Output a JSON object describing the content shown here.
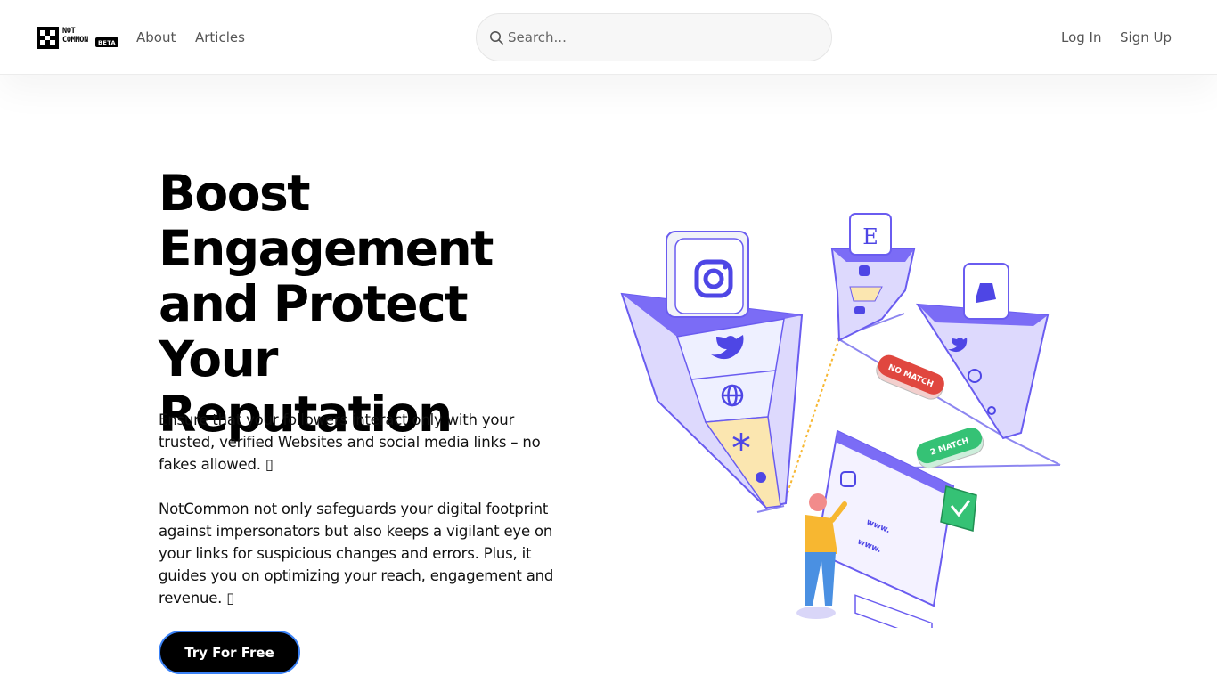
{
  "header": {
    "logo": {
      "line1": "NOT",
      "line2": "COMMON",
      "badge": "BETA"
    },
    "nav": {
      "about": "About",
      "articles": "Articles"
    },
    "search": {
      "placeholder": "Search...",
      "value": ""
    },
    "auth": {
      "login": "Log In",
      "signup": "Sign Up"
    }
  },
  "hero": {
    "title": "Boost Engagement and Protect Your Reputation",
    "paragraph1": "Ensure that your followers interact only with your trusted, verified Websites and social media links – no fakes allowed. ▯",
    "paragraph2": "NotCommon not only safeguards your digital footprint against impersonators but also keeps a vigilant eye on your links for suspicious changes and errors. Plus, it guides you on optimizing your reach, engagement and revenue. ▯",
    "cta": "Try For Free"
  },
  "illustration": {
    "badge_no_match": "NO MATCH",
    "badge_match": "2 MATCH",
    "url_text": "www.",
    "funnel_letter": "E",
    "icons": [
      "instagram-icon",
      "twitter-icon",
      "globe-icon",
      "asterisk-icon",
      "etsy-icon",
      "tiktok-icon",
      "discord-icon",
      "shopify-icon",
      "link-icon",
      "checkmark-icon"
    ],
    "colors": {
      "funnel": "#7b6cf6",
      "funnel_light": "#c9c3fb",
      "match": "#35c275",
      "no_match": "#e0473f",
      "person_shirt": "#f7b731",
      "person_jeans": "#4a90e2"
    }
  },
  "colors": {
    "cta_bg": "#000000",
    "cta_border": "#3b82f6",
    "text": "#000000",
    "nav": "#555555"
  }
}
